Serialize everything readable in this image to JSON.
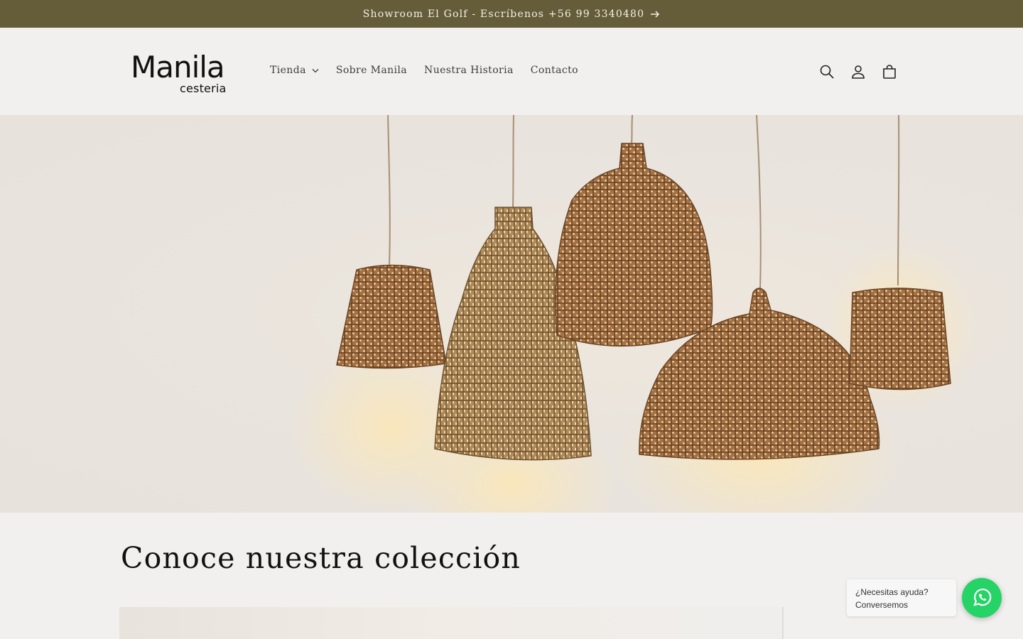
{
  "announcement": {
    "text": "Showroom El Golf - Escríbenos +56 99 3340480"
  },
  "logo": {
    "main": "Manila",
    "sub": "cesteria"
  },
  "nav": {
    "items": [
      {
        "label": "Tienda",
        "has_dropdown": true
      },
      {
        "label": "Sobre Manila"
      },
      {
        "label": "Nuestra Historia"
      },
      {
        "label": "Contacto"
      }
    ]
  },
  "header_icons": [
    "search-icon",
    "account-icon",
    "cart-icon"
  ],
  "hero": {
    "image": "woven wicker pendant lamps"
  },
  "section": {
    "title": "Conoce nuestra colección"
  },
  "whatsapp": {
    "line1": "¿Necesitas ayuda?",
    "line2": "Conversemos"
  },
  "colors": {
    "announcement_bg": "#655d3a",
    "page_bg": "#f1f0ee",
    "whatsapp_green": "#25d366"
  }
}
